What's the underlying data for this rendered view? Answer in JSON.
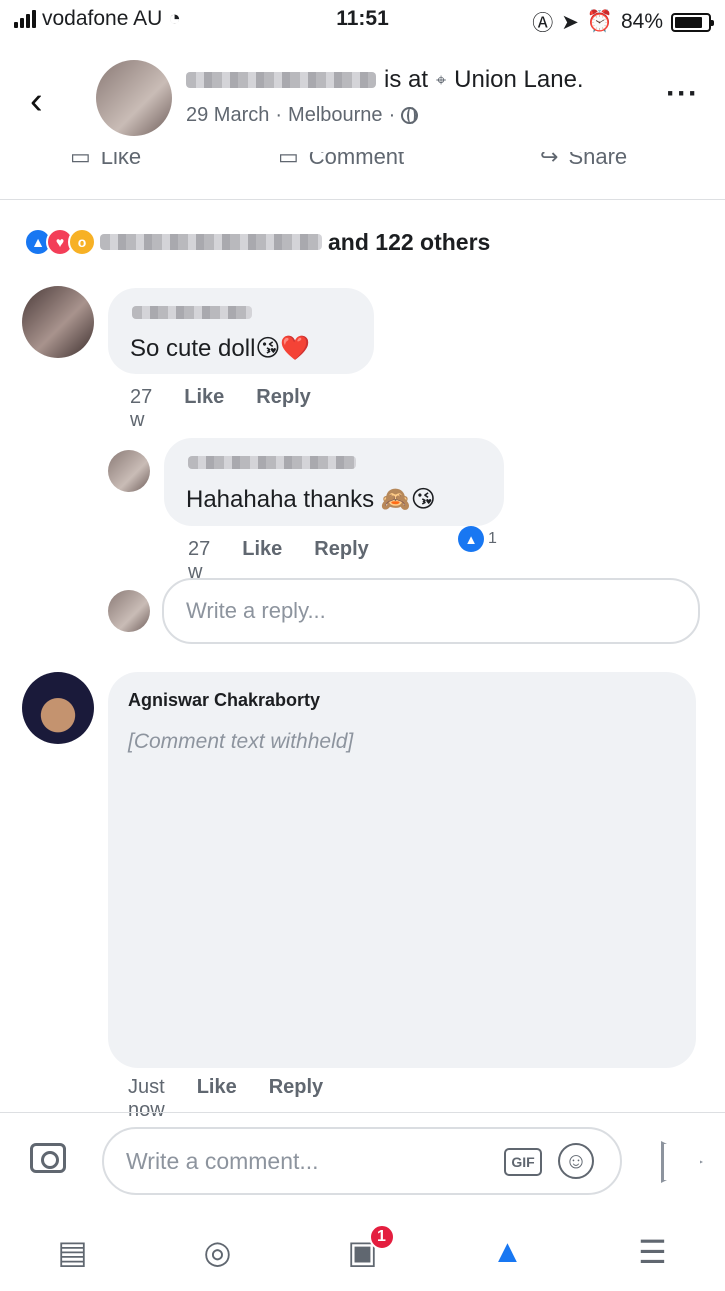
{
  "status_bar": {
    "carrier": "vodafone AU",
    "time": "11:51",
    "battery": "84%",
    "battery_level": 0.84
  },
  "post_header": {
    "checkin_text": "is at",
    "location": "Union Lane.",
    "date": "29 March",
    "city": "Melbourne"
  },
  "post_actions": [
    "Like",
    "Comment",
    "Share"
  ],
  "reactions": {
    "others_text": "and 122 others"
  },
  "comments": [
    {
      "text": "So cute doll😘❤️",
      "time": "27 w",
      "like_label": "Like",
      "reply_label": "Reply"
    },
    {
      "text": "Hahahaha thanks 🙈😘",
      "time": "27 w",
      "like_label": "Like",
      "reply_label": "Reply",
      "like_count": "1"
    },
    {
      "author": "Agniswar Chakraborty",
      "time": "Just now",
      "like_label": "Like",
      "reply_label": "Reply"
    }
  ],
  "withheld_notice": "[Comment text withheld]",
  "reply_placeholder": "Write a reply...",
  "composer": {
    "placeholder": "Write a comment...",
    "gif_label": "GIF"
  },
  "tab_bar": {
    "marketplace_badge": "1"
  }
}
